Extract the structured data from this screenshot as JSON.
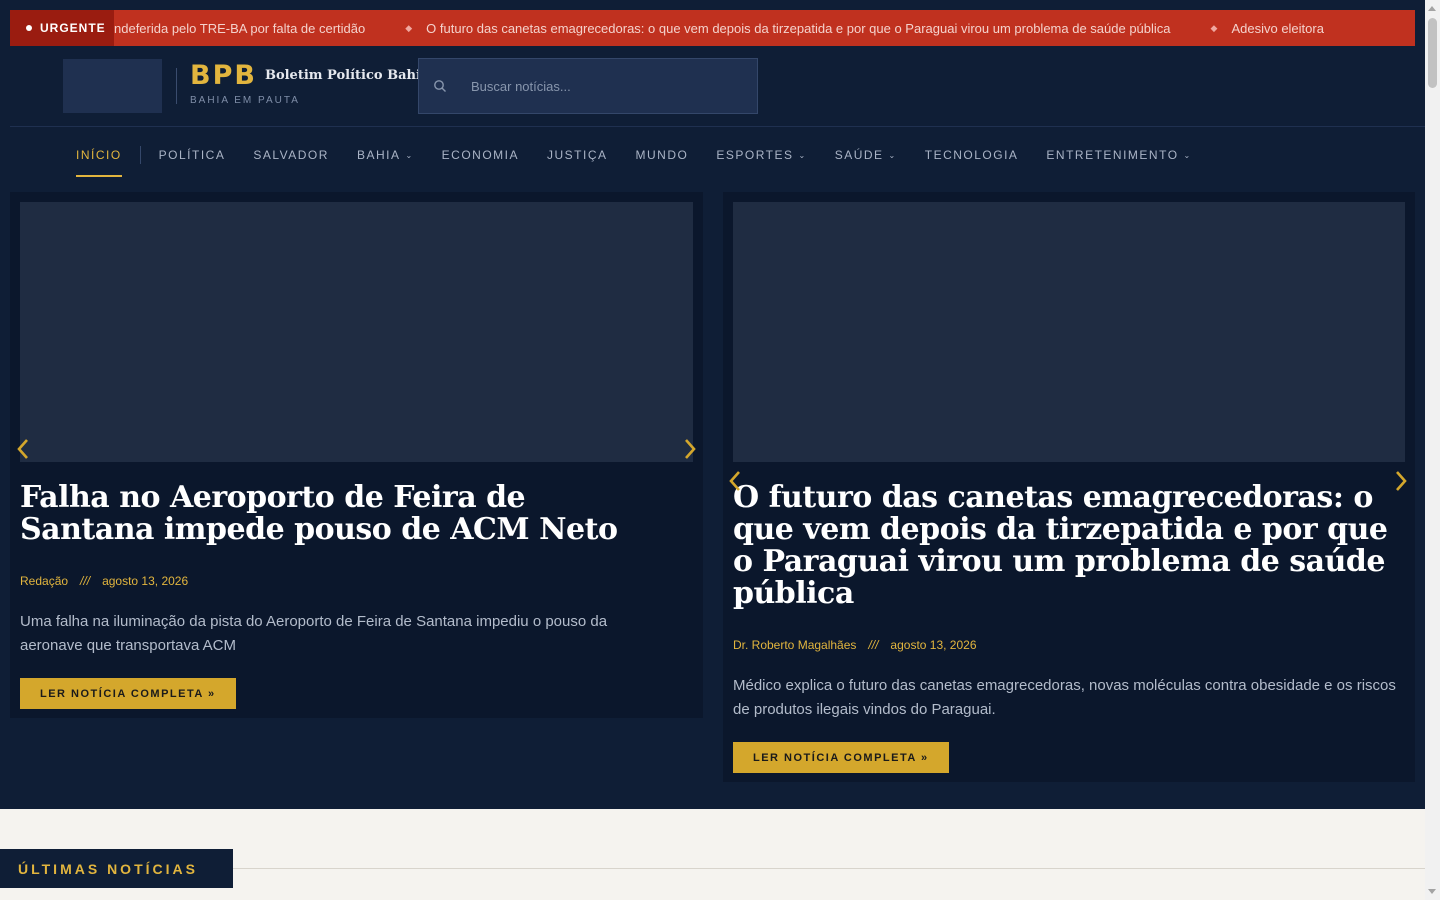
{
  "ticker": {
    "label": "URGENTE",
    "items": [
      "ndeferida pelo TRE-BA por falta de certidão",
      "O futuro das canetas emagrecedoras: o que vem depois da tirzepatida e por que o Paraguai virou um problema de saúde pública",
      "Adesivo eleitora"
    ]
  },
  "header": {
    "brand_abbr": "BPB",
    "brand_name": "Boletim Político Bahia",
    "tagline": "BAHIA EM PAUTA",
    "search_placeholder": "Buscar notícias..."
  },
  "nav": {
    "items": [
      {
        "label": "INÍCIO",
        "active": true,
        "dropdown": false
      },
      {
        "label": "POLÍTICA",
        "active": false,
        "dropdown": false
      },
      {
        "label": "SALVADOR",
        "active": false,
        "dropdown": false
      },
      {
        "label": "BAHIA",
        "active": false,
        "dropdown": true
      },
      {
        "label": "ECONOMIA",
        "active": false,
        "dropdown": false
      },
      {
        "label": "JUSTIÇA",
        "active": false,
        "dropdown": false
      },
      {
        "label": "MUNDO",
        "active": false,
        "dropdown": false
      },
      {
        "label": "ESPORTES",
        "active": false,
        "dropdown": true
      },
      {
        "label": "SAÚDE",
        "active": false,
        "dropdown": true
      },
      {
        "label": "TECNOLOGIA",
        "active": false,
        "dropdown": false
      },
      {
        "label": "ENTRETENIMENTO",
        "active": false,
        "dropdown": true
      }
    ]
  },
  "slides": [
    {
      "title": "Falha no Aeroporto de Feira de Santana impede pouso de ACM Neto",
      "author": "Redação",
      "meta_sep": "///",
      "date": "agosto 13, 2026",
      "excerpt": "Uma falha na iluminação da pista do Aeroporto de Feira de Santana impediu o pouso da aeronave que transportava ACM",
      "button": "LER NOTÍCIA COMPLETA »"
    },
    {
      "title": "O futuro das canetas emagrecedoras: o que vem depois da tirzepatida e por que o Paraguai virou um problema de saúde pública",
      "author": "Dr. Roberto Magalhães",
      "meta_sep": "///",
      "date": "agosto 13, 2026",
      "excerpt": "Médico explica o futuro das canetas emagrecedoras, novas moléculas contra obesidade e os riscos de produtos ilegais vindos do Paraguai.",
      "button": "LER NOTÍCIA COMPLETA »"
    }
  ],
  "section": {
    "title": "ÚLTIMAS NOTÍCIAS"
  },
  "colors": {
    "background": "#0f1e36",
    "accent": "#e2b53e",
    "ticker": "#c0311f",
    "button": "#d4a72c"
  },
  "icons": {
    "search": "search-icon",
    "prev": "chevron-left-icon",
    "next": "chevron-right-icon",
    "dropdown": "chevron-down-icon"
  }
}
